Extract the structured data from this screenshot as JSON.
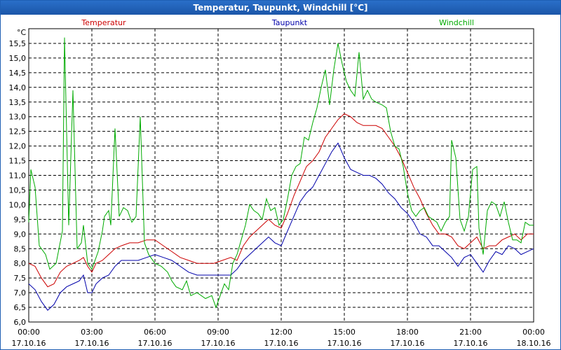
{
  "window": {
    "title": "Temperatur, Taupunkt, Windchill [°C]"
  },
  "chart_data": {
    "type": "line",
    "title": "Temperatur, Taupunkt, Windchill [°C]",
    "ylabel": "°C",
    "ylim": [
      6.0,
      16.0
    ],
    "xlim": [
      0,
      24
    ],
    "grid": true,
    "legend_position": "top",
    "y_ticks": [
      "6,0",
      "6,5",
      "7,0",
      "7,5",
      "8,0",
      "8,5",
      "9,0",
      "9,5",
      "10,0",
      "10,5",
      "11,0",
      "11,5",
      "12,0",
      "12,5",
      "13,0",
      "13,5",
      "14,0",
      "14,5",
      "15,0",
      "15,5"
    ],
    "x_ticks": [
      {
        "hours": 0,
        "time": "00:00",
        "date": "17.10.16"
      },
      {
        "hours": 3,
        "time": "03:00",
        "date": "17.10.16"
      },
      {
        "hours": 6,
        "time": "06:00",
        "date": "17.10.16"
      },
      {
        "hours": 9,
        "time": "09:00",
        "date": "17.10.16"
      },
      {
        "hours": 12,
        "time": "12:00",
        "date": "17.10.16"
      },
      {
        "hours": 15,
        "time": "15:00",
        "date": "17.10.16"
      },
      {
        "hours": 18,
        "time": "18:00",
        "date": "17.10.16"
      },
      {
        "hours": 21,
        "time": "21:00",
        "date": "17.10.16"
      },
      {
        "hours": 24,
        "time": "00:00",
        "date": "18.10.16"
      }
    ],
    "series": [
      {
        "name": "Temperatur",
        "color": "#cc0000",
        "points": [
          [
            0,
            8.0
          ],
          [
            0.3,
            7.9
          ],
          [
            0.6,
            7.5
          ],
          [
            0.9,
            7.2
          ],
          [
            1.2,
            7.3
          ],
          [
            1.5,
            7.7
          ],
          [
            1.8,
            7.9
          ],
          [
            2.1,
            8.0
          ],
          [
            2.4,
            8.1
          ],
          [
            2.6,
            8.2
          ],
          [
            2.8,
            7.9
          ],
          [
            3.0,
            7.7
          ],
          [
            3.2,
            8.0
          ],
          [
            3.5,
            8.1
          ],
          [
            3.8,
            8.3
          ],
          [
            4.1,
            8.5
          ],
          [
            4.4,
            8.6
          ],
          [
            4.8,
            8.7
          ],
          [
            5.2,
            8.7
          ],
          [
            5.6,
            8.8
          ],
          [
            6.0,
            8.8
          ],
          [
            6.4,
            8.6
          ],
          [
            6.8,
            8.4
          ],
          [
            7.2,
            8.2
          ],
          [
            7.6,
            8.1
          ],
          [
            8.0,
            8.0
          ],
          [
            8.4,
            8.0
          ],
          [
            8.8,
            8.0
          ],
          [
            9.2,
            8.1
          ],
          [
            9.6,
            8.2
          ],
          [
            9.9,
            8.1
          ],
          [
            10.2,
            8.6
          ],
          [
            10.5,
            8.9
          ],
          [
            10.8,
            9.1
          ],
          [
            11.1,
            9.3
          ],
          [
            11.4,
            9.5
          ],
          [
            11.7,
            9.3
          ],
          [
            12.0,
            9.2
          ],
          [
            12.3,
            9.7
          ],
          [
            12.6,
            10.3
          ],
          [
            12.9,
            10.8
          ],
          [
            13.2,
            11.3
          ],
          [
            13.5,
            11.5
          ],
          [
            13.8,
            11.8
          ],
          [
            14.1,
            12.3
          ],
          [
            14.4,
            12.6
          ],
          [
            14.7,
            12.9
          ],
          [
            15.0,
            13.1
          ],
          [
            15.3,
            13.0
          ],
          [
            15.6,
            12.8
          ],
          [
            15.9,
            12.7
          ],
          [
            16.2,
            12.7
          ],
          [
            16.5,
            12.7
          ],
          [
            16.8,
            12.6
          ],
          [
            17.1,
            12.3
          ],
          [
            17.4,
            12.0
          ],
          [
            17.7,
            11.6
          ],
          [
            18.0,
            11.1
          ],
          [
            18.3,
            10.6
          ],
          [
            18.6,
            10.2
          ],
          [
            18.9,
            9.7
          ],
          [
            19.2,
            9.3
          ],
          [
            19.5,
            9.0
          ],
          [
            19.8,
            9.0
          ],
          [
            20.1,
            8.9
          ],
          [
            20.4,
            8.6
          ],
          [
            20.7,
            8.5
          ],
          [
            21.0,
            8.7
          ],
          [
            21.3,
            8.9
          ],
          [
            21.6,
            8.5
          ],
          [
            21.9,
            8.6
          ],
          [
            22.2,
            8.6
          ],
          [
            22.5,
            8.8
          ],
          [
            22.8,
            8.9
          ],
          [
            23.1,
            9.0
          ],
          [
            23.4,
            8.8
          ],
          [
            23.7,
            9.0
          ],
          [
            24.0,
            9.0
          ]
        ]
      },
      {
        "name": "Taupunkt",
        "color": "#0000aa",
        "points": [
          [
            0,
            7.3
          ],
          [
            0.3,
            7.1
          ],
          [
            0.6,
            6.7
          ],
          [
            0.9,
            6.4
          ],
          [
            1.2,
            6.6
          ],
          [
            1.5,
            7.0
          ],
          [
            1.8,
            7.2
          ],
          [
            2.1,
            7.3
          ],
          [
            2.4,
            7.4
          ],
          [
            2.6,
            7.6
          ],
          [
            2.8,
            7.0
          ],
          [
            3.0,
            7.0
          ],
          [
            3.2,
            7.3
          ],
          [
            3.5,
            7.5
          ],
          [
            3.8,
            7.6
          ],
          [
            4.1,
            7.9
          ],
          [
            4.4,
            8.1
          ],
          [
            4.8,
            8.1
          ],
          [
            5.2,
            8.1
          ],
          [
            5.6,
            8.2
          ],
          [
            6.0,
            8.3
          ],
          [
            6.4,
            8.2
          ],
          [
            6.8,
            8.1
          ],
          [
            7.2,
            7.9
          ],
          [
            7.6,
            7.7
          ],
          [
            8.0,
            7.6
          ],
          [
            8.4,
            7.6
          ],
          [
            8.8,
            7.6
          ],
          [
            9.2,
            7.6
          ],
          [
            9.6,
            7.6
          ],
          [
            9.9,
            7.8
          ],
          [
            10.2,
            8.1
          ],
          [
            10.5,
            8.3
          ],
          [
            10.8,
            8.5
          ],
          [
            11.1,
            8.7
          ],
          [
            11.4,
            8.9
          ],
          [
            11.7,
            8.7
          ],
          [
            12.0,
            8.6
          ],
          [
            12.3,
            9.1
          ],
          [
            12.6,
            9.6
          ],
          [
            12.9,
            10.1
          ],
          [
            13.2,
            10.4
          ],
          [
            13.5,
            10.6
          ],
          [
            13.8,
            11.0
          ],
          [
            14.1,
            11.4
          ],
          [
            14.4,
            11.8
          ],
          [
            14.7,
            12.1
          ],
          [
            15.0,
            11.6
          ],
          [
            15.3,
            11.2
          ],
          [
            15.6,
            11.1
          ],
          [
            15.9,
            11.0
          ],
          [
            16.2,
            11.0
          ],
          [
            16.5,
            10.9
          ],
          [
            16.8,
            10.7
          ],
          [
            17.1,
            10.4
          ],
          [
            17.4,
            10.2
          ],
          [
            17.7,
            9.9
          ],
          [
            18.0,
            9.7
          ],
          [
            18.3,
            9.4
          ],
          [
            18.6,
            9.0
          ],
          [
            18.9,
            8.9
          ],
          [
            19.2,
            8.6
          ],
          [
            19.5,
            8.6
          ],
          [
            19.8,
            8.4
          ],
          [
            20.1,
            8.2
          ],
          [
            20.4,
            7.9
          ],
          [
            20.7,
            8.2
          ],
          [
            21.0,
            8.3
          ],
          [
            21.3,
            8.0
          ],
          [
            21.6,
            7.7
          ],
          [
            21.9,
            8.1
          ],
          [
            22.2,
            8.4
          ],
          [
            22.5,
            8.3
          ],
          [
            22.8,
            8.6
          ],
          [
            23.1,
            8.5
          ],
          [
            23.4,
            8.3
          ],
          [
            23.7,
            8.4
          ],
          [
            24.0,
            8.5
          ]
        ]
      },
      {
        "name": "Windchill",
        "color": "#00aa00",
        "points": [
          [
            0,
            9.4
          ],
          [
            0.1,
            11.2
          ],
          [
            0.3,
            10.6
          ],
          [
            0.5,
            8.6
          ],
          [
            0.8,
            8.3
          ],
          [
            1.0,
            7.8
          ],
          [
            1.3,
            8.0
          ],
          [
            1.6,
            9.1
          ],
          [
            1.7,
            15.7
          ],
          [
            1.9,
            9.3
          ],
          [
            2.1,
            13.9
          ],
          [
            2.3,
            8.5
          ],
          [
            2.5,
            8.7
          ],
          [
            2.6,
            9.3
          ],
          [
            2.8,
            8.0
          ],
          [
            3.0,
            7.8
          ],
          [
            3.3,
            8.4
          ],
          [
            3.5,
            9.1
          ],
          [
            3.6,
            9.6
          ],
          [
            3.8,
            9.8
          ],
          [
            3.9,
            9.3
          ],
          [
            4.1,
            12.6
          ],
          [
            4.3,
            9.6
          ],
          [
            4.5,
            9.9
          ],
          [
            4.7,
            9.8
          ],
          [
            4.9,
            9.4
          ],
          [
            5.1,
            9.6
          ],
          [
            5.3,
            13.0
          ],
          [
            5.5,
            8.7
          ],
          [
            5.7,
            8.3
          ],
          [
            6.0,
            8.0
          ],
          [
            6.3,
            7.9
          ],
          [
            6.6,
            7.7
          ],
          [
            6.8,
            7.4
          ],
          [
            7.0,
            7.2
          ],
          [
            7.3,
            7.1
          ],
          [
            7.5,
            7.4
          ],
          [
            7.7,
            6.9
          ],
          [
            8.0,
            7.0
          ],
          [
            8.4,
            6.8
          ],
          [
            8.7,
            6.9
          ],
          [
            8.9,
            6.5
          ],
          [
            9.1,
            6.9
          ],
          [
            9.3,
            7.3
          ],
          [
            9.5,
            7.1
          ],
          [
            9.7,
            8.0
          ],
          [
            9.9,
            8.3
          ],
          [
            10.1,
            8.8
          ],
          [
            10.3,
            9.3
          ],
          [
            10.5,
            10.0
          ],
          [
            10.7,
            9.8
          ],
          [
            10.9,
            9.7
          ],
          [
            11.1,
            9.5
          ],
          [
            11.3,
            10.2
          ],
          [
            11.5,
            9.8
          ],
          [
            11.7,
            9.9
          ],
          [
            11.9,
            9.3
          ],
          [
            12.1,
            9.5
          ],
          [
            12.3,
            10.2
          ],
          [
            12.5,
            11.0
          ],
          [
            12.7,
            11.3
          ],
          [
            12.9,
            11.4
          ],
          [
            13.1,
            12.3
          ],
          [
            13.3,
            12.2
          ],
          [
            13.5,
            12.8
          ],
          [
            13.7,
            13.3
          ],
          [
            13.9,
            14.0
          ],
          [
            14.1,
            14.6
          ],
          [
            14.3,
            13.4
          ],
          [
            14.5,
            14.6
          ],
          [
            14.7,
            15.5
          ],
          [
            14.9,
            14.8
          ],
          [
            15.1,
            14.2
          ],
          [
            15.3,
            13.9
          ],
          [
            15.5,
            13.7
          ],
          [
            15.7,
            15.2
          ],
          [
            15.9,
            13.6
          ],
          [
            16.1,
            13.9
          ],
          [
            16.3,
            13.6
          ],
          [
            16.5,
            13.5
          ],
          [
            16.8,
            13.4
          ],
          [
            17.0,
            13.3
          ],
          [
            17.2,
            12.5
          ],
          [
            17.4,
            12.0
          ],
          [
            17.6,
            11.9
          ],
          [
            17.8,
            11.3
          ],
          [
            18.0,
            10.4
          ],
          [
            18.2,
            9.8
          ],
          [
            18.4,
            9.6
          ],
          [
            18.6,
            9.8
          ],
          [
            18.8,
            9.9
          ],
          [
            19.0,
            9.6
          ],
          [
            19.2,
            9.5
          ],
          [
            19.4,
            9.4
          ],
          [
            19.6,
            9.1
          ],
          [
            19.8,
            9.4
          ],
          [
            20.0,
            9.6
          ],
          [
            20.1,
            12.2
          ],
          [
            20.3,
            11.6
          ],
          [
            20.5,
            9.5
          ],
          [
            20.7,
            9.1
          ],
          [
            20.9,
            9.6
          ],
          [
            21.1,
            11.2
          ],
          [
            21.3,
            11.3
          ],
          [
            21.4,
            9.2
          ],
          [
            21.6,
            8.3
          ],
          [
            21.8,
            9.8
          ],
          [
            22.0,
            10.1
          ],
          [
            22.2,
            10.0
          ],
          [
            22.4,
            9.6
          ],
          [
            22.6,
            10.1
          ],
          [
            22.8,
            9.4
          ],
          [
            23.0,
            8.8
          ],
          [
            23.2,
            8.8
          ],
          [
            23.4,
            8.7
          ],
          [
            23.6,
            9.4
          ],
          [
            23.8,
            9.3
          ],
          [
            24.0,
            9.3
          ]
        ]
      }
    ]
  }
}
